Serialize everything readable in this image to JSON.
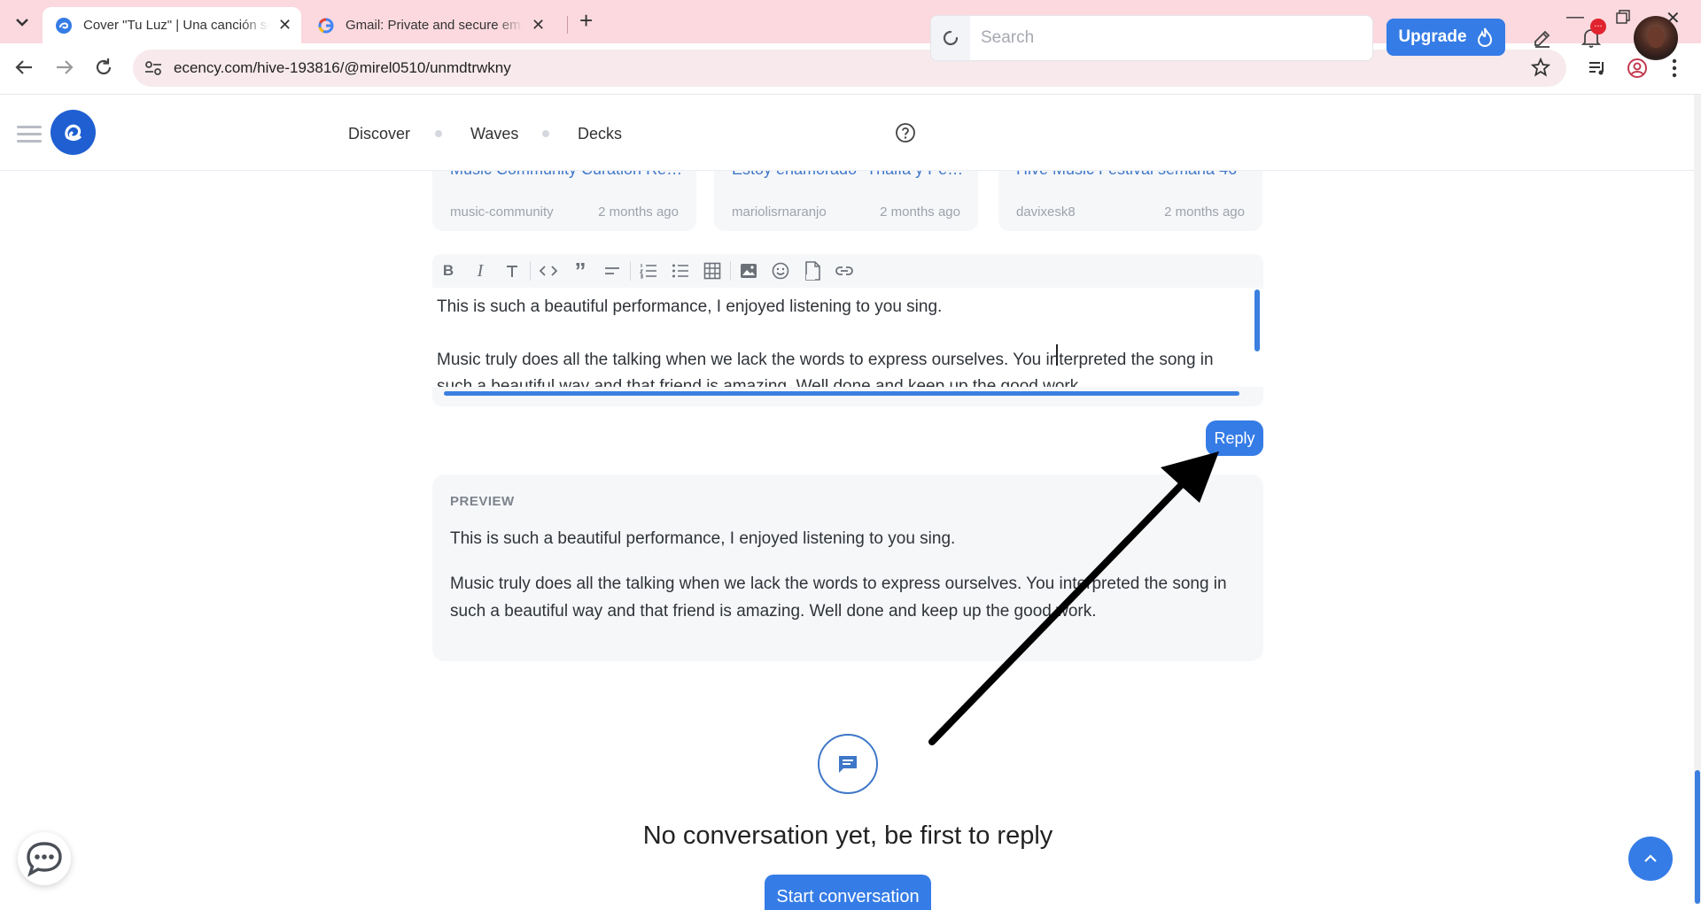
{
  "browser": {
    "tabs": [
      {
        "title": "Cover \"Tu Luz\" | Una canción sobre",
        "active": true,
        "favicon": "ecency-icon"
      },
      {
        "title": "Gmail: Private and secure email",
        "active": false,
        "favicon": "google-icon"
      }
    ],
    "new_tab_symbol": "+",
    "url": "ecency.com/hive-193816/@mirel0510/unmdtrwkny"
  },
  "site": {
    "nav": [
      "Discover",
      "Waves",
      "Decks"
    ],
    "search_placeholder": "Search",
    "upgrade_label": "Upgrade",
    "notification_badge": "..."
  },
  "related_cards": [
    {
      "title": "Music Community Curation Report",
      "author": "music-community",
      "time": "2 months ago"
    },
    {
      "title": "Estoy enamorado -Thalía y Pedro Capó",
      "author": "mariolisrnaranjo",
      "time": "2 months ago"
    },
    {
      "title": "Hive Music Festival semana 46",
      "author": "davixesk8",
      "time": "2 months ago"
    }
  ],
  "editor": {
    "toolbar": [
      "bold-icon",
      "italic-icon",
      "heading-icon",
      "code-icon",
      "quote-icon",
      "align-icon",
      "ordered-list-icon",
      "bullet-list-icon",
      "table-icon",
      "image-icon",
      "emoji-icon",
      "gif-icon",
      "link-icon"
    ],
    "line1": "This is such  a beautiful performance, I enjoyed listening to you sing.",
    "line2": "Music truly does all the talking when we lack the words to express ourselves. You interpreted the song in",
    "line3": "such a beautiful way and that friend is amazing. Well done and keep up the good work."
  },
  "reply_label": "Reply",
  "preview": {
    "label": "PREVIEW",
    "p1": "This is such a beautiful performance, I enjoyed listening to you sing.",
    "p2": "Music truly does all the talking when we lack the words to express ourselves. You interpreted the song in such a beautiful way and that friend is amazing. Well done and keep up the good work."
  },
  "conversation": {
    "empty_text": "No conversation yet, be first to reply",
    "start_label": "Start conversation"
  },
  "colors": {
    "accent": "#357ce6",
    "tabstrip": "#fbd9df",
    "arrow": "#000000"
  }
}
